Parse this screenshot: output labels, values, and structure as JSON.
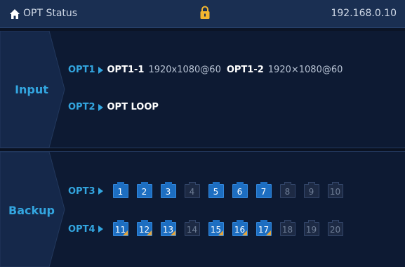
{
  "header": {
    "title": "OPT Status",
    "ip": "192.168.0.10",
    "icons": {
      "home": "home-icon",
      "lock": "lock-icon"
    }
  },
  "input": {
    "label": "Input",
    "rows": [
      {
        "name": "OPT1",
        "sources": [
          {
            "name": "OPT1-1",
            "resolution": "1920x1080@60"
          },
          {
            "name": "OPT1-2",
            "resolution": "1920×1080@60"
          }
        ]
      },
      {
        "name": "OPT2",
        "sources": [
          {
            "name": "OPT LOOP",
            "resolution": ""
          }
        ]
      }
    ]
  },
  "backup": {
    "label": "Backup",
    "rows": [
      {
        "name": "OPT3",
        "ports": [
          {
            "label": "1",
            "active": true,
            "marked": false
          },
          {
            "label": "2",
            "active": true,
            "marked": false
          },
          {
            "label": "3",
            "active": true,
            "marked": false
          },
          {
            "label": "4",
            "active": false,
            "marked": false
          },
          {
            "label": "5",
            "active": true,
            "marked": false
          },
          {
            "label": "6",
            "active": true,
            "marked": false
          },
          {
            "label": "7",
            "active": true,
            "marked": false
          },
          {
            "label": "8",
            "active": false,
            "marked": false
          },
          {
            "label": "9",
            "active": false,
            "marked": false
          },
          {
            "label": "10",
            "active": false,
            "marked": false
          }
        ]
      },
      {
        "name": "OPT4",
        "ports": [
          {
            "label": "11",
            "active": true,
            "marked": true
          },
          {
            "label": "12",
            "active": true,
            "marked": true
          },
          {
            "label": "13",
            "active": true,
            "marked": true
          },
          {
            "label": "14",
            "active": false,
            "marked": false
          },
          {
            "label": "15",
            "active": true,
            "marked": true
          },
          {
            "label": "16",
            "active": true,
            "marked": true
          },
          {
            "label": "17",
            "active": true,
            "marked": true
          },
          {
            "label": "18",
            "active": false,
            "marked": false
          },
          {
            "label": "19",
            "active": false,
            "marked": false
          },
          {
            "label": "20",
            "active": false,
            "marked": false
          }
        ]
      }
    ]
  },
  "colors": {
    "accent": "#33a6e0",
    "active_port": "#1d6ec1",
    "inactive_port": "#1d2a44",
    "marker": "#e6a43a"
  }
}
